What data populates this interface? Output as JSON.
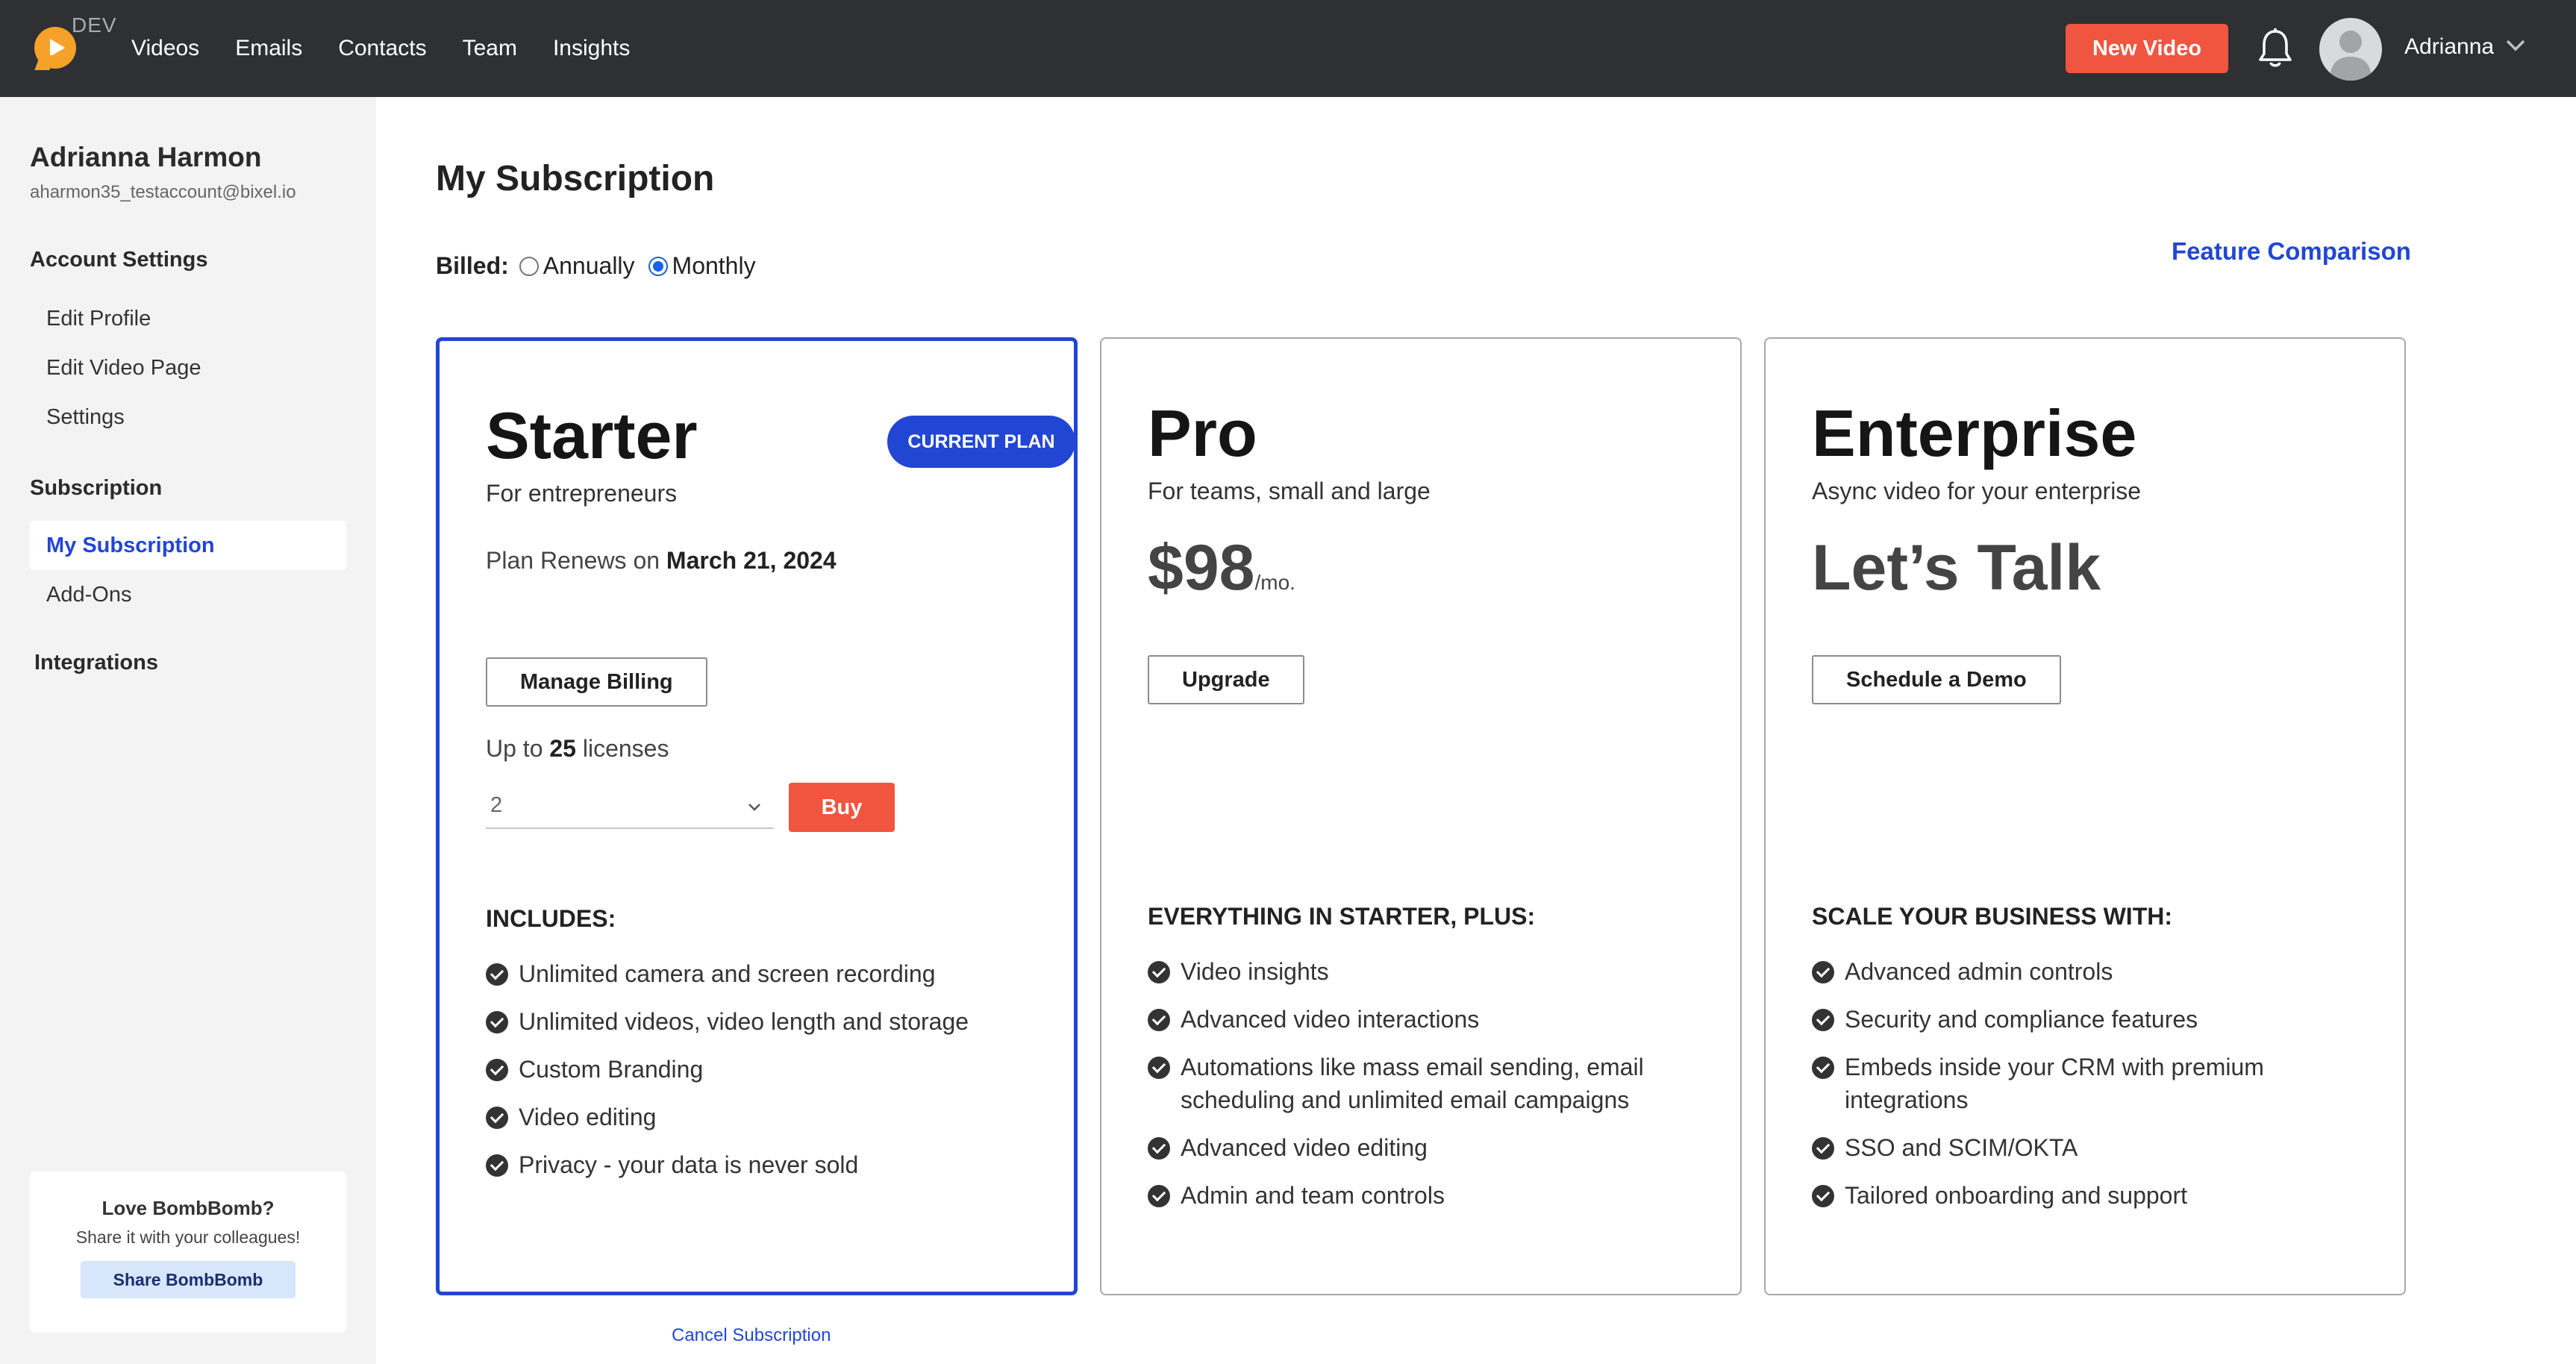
{
  "app": {
    "env_tag": "DEV",
    "nav": [
      "Videos",
      "Emails",
      "Contacts",
      "Team",
      "Insights"
    ],
    "new_video_label": "New Video",
    "user_short_name": "Adrianna",
    "colors": {
      "topbar": "#2f3033",
      "accent": "#2246d4",
      "cta": "#f0553f",
      "logo": "#f5a12a"
    },
    "icons": {
      "logo": "play-logo-icon",
      "bell": "bell-icon",
      "avatar": "user-avatar-icon",
      "menu": "chevron-down-icon"
    }
  },
  "sidebar": {
    "user_name": "Adrianna Harmon",
    "user_email": "aharmon35_testaccount@bixel.io",
    "account_settings_title": "Account Settings",
    "account_items": [
      "Edit Profile",
      "Edit Video Page",
      "Settings"
    ],
    "subscription_title": "Subscription",
    "subscription_items": [
      "My Subscription",
      "Add-Ons"
    ],
    "active_item": "My Subscription",
    "integrations_title": "Integrations",
    "share_card": {
      "title": "Love BombBomb?",
      "subtitle": "Share it with your colleagues!",
      "button": "Share BombBomb"
    }
  },
  "main": {
    "title": "My Subscription",
    "billed_label": "Billed:",
    "billing_options": [
      "Annually",
      "Monthly"
    ],
    "billing_selected": "Monthly",
    "feature_comparison_link": "Feature Comparison",
    "cancel_link": "Cancel Subscription"
  },
  "plans": {
    "starter": {
      "name": "Starter",
      "subtitle": "For entrepreneurs",
      "badge": "CURRENT PLAN",
      "renews_prefix": "Plan Renews on",
      "renews_date": "March 21, 2024",
      "button": "Manage Billing",
      "licenses_prefix": "Up to",
      "licenses_count": "25",
      "licenses_suffix": "licenses",
      "quantity_value": "2",
      "buy_button": "Buy",
      "features_title": "INCLUDES:",
      "features": [
        "Unlimited camera and screen recording",
        "Unlimited videos, video length and storage",
        "Custom Branding",
        "Video editing",
        "Privacy - your data is never sold"
      ]
    },
    "pro": {
      "name": "Pro",
      "subtitle": "For teams, small and large",
      "price": "$98",
      "price_unit": "/mo.",
      "button": "Upgrade",
      "features_title": "EVERYTHING IN STARTER, PLUS:",
      "features": [
        "Video insights",
        "Advanced video interactions",
        "Automations like mass email sending, email scheduling and unlimited email campaigns",
        "Advanced video editing",
        "Admin and team controls"
      ]
    },
    "enterprise": {
      "name": "Enterprise",
      "subtitle": "Async video for your enterprise",
      "price_text": "Let’s Talk",
      "button": "Schedule a Demo",
      "features_title": "SCALE YOUR BUSINESS WITH:",
      "features": [
        "Advanced admin controls",
        "Security and compliance features",
        "Embeds inside your CRM with premium integrations",
        "SSO and SCIM/OKTA",
        "Tailored onboarding and support"
      ]
    }
  }
}
